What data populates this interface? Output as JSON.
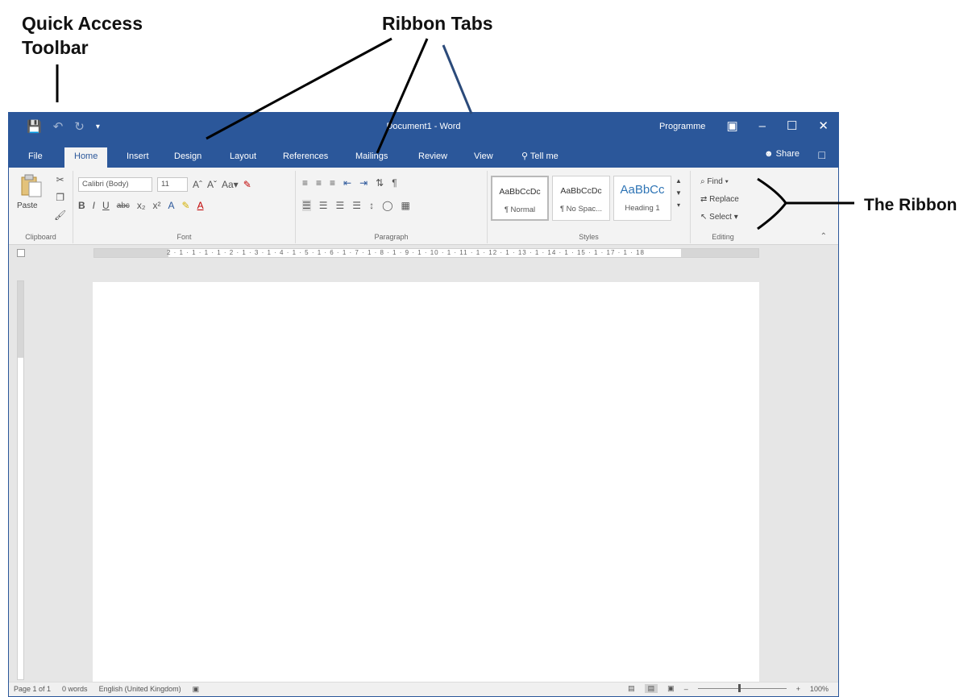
{
  "annotations": {
    "qat_line1": "Quick Access",
    "qat_line2": "Toolbar",
    "ribbon_tabs": "Ribbon Tabs",
    "the_ribbon": "The Ribbon"
  },
  "titlebar": {
    "title": "Document1 - Word",
    "account": "Programme"
  },
  "tabs": [
    {
      "label": "File"
    },
    {
      "label": "Home"
    },
    {
      "label": "Insert"
    },
    {
      "label": "Design"
    },
    {
      "label": "Layout"
    },
    {
      "label": "References"
    },
    {
      "label": "Mailings"
    },
    {
      "label": "Review"
    },
    {
      "label": "View"
    },
    {
      "label": "Tell me"
    }
  ],
  "share_label": "Share",
  "ribbon": {
    "clipboard": {
      "label": "Clipboard",
      "paste": "Paste"
    },
    "font": {
      "label": "Font",
      "name": "Calibri (Body)",
      "size": "11"
    },
    "paragraph": {
      "label": "Paragraph"
    },
    "styles": {
      "label": "Styles",
      "items": [
        {
          "sample": "AaBbCcDc",
          "name": "¶ Normal"
        },
        {
          "sample": "AaBbCcDc",
          "name": "¶ No Spac..."
        },
        {
          "sample": "AaBbCc",
          "name": "Heading 1"
        }
      ]
    },
    "editing": {
      "label": "Editing",
      "find": "Find",
      "replace": "Replace",
      "select": "Select"
    }
  },
  "ruler_numbers": "2 · 1 · 1 · 1 · 1 · 2 · 1 · 3 · 1 · 4 · 1 · 5 · 1 · 6 · 1 · 7 · 1 · 8 · 1 · 9 · 1 · 10 · 1 · 11 · 1 · 12 · 1 · 13 · 1 · 14 · 1 · 15 · 1 · 17 · 1 · 18",
  "status": {
    "page": "Page 1 of 1",
    "words": "0 words",
    "language": "English (United Kingdom)",
    "zoom": "100%"
  }
}
